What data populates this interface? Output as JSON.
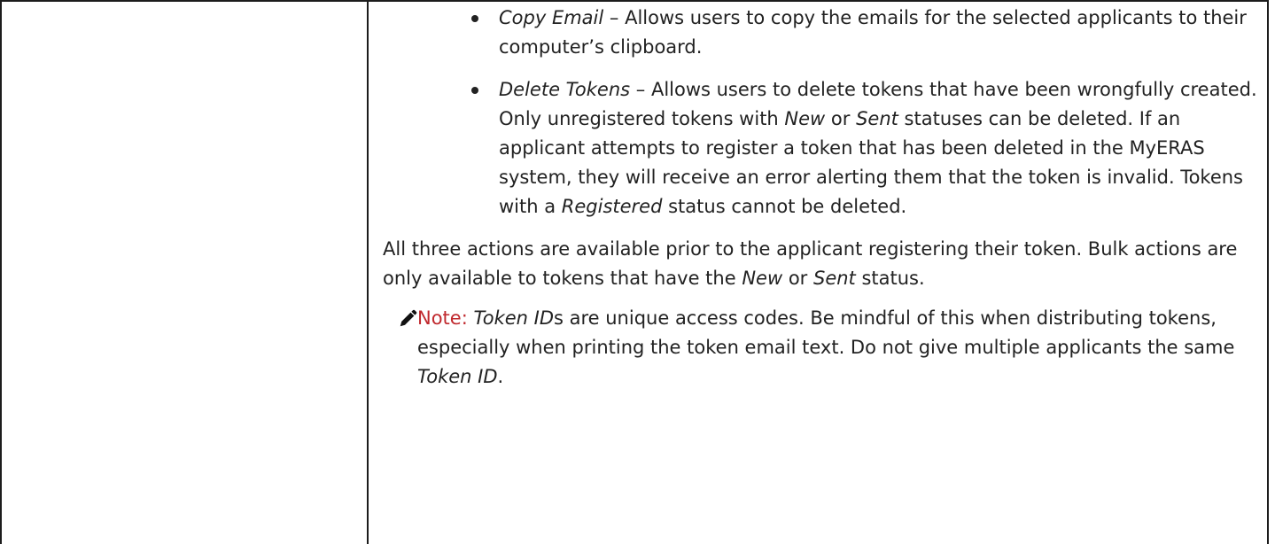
{
  "bullets": [
    {
      "term": "Copy Email",
      "dash": " – ",
      "text": "Allows users to copy the emails for the selected applicants to their computer’s clipboard."
    },
    {
      "term": "Delete Tokens",
      "dash": " – ",
      "text_1": "Allows users to delete tokens that have been wrongfully created. Only unregistered tokens with ",
      "em_1": "New",
      "text_2": " or ",
      "em_2": "Sent",
      "text_3": " statuses can be deleted. If an applicant attempts to register a token that has been deleted in the MyERAS system, they will receive an error alerting them that the token is invalid. Tokens with a ",
      "em_3": "Registered",
      "text_4": " status cannot be deleted."
    }
  ],
  "paragraph": {
    "line_1": "All three actions are available prior to the applicant registering their token. Bulk actions are only available to tokens that have the ",
    "em_1": "New",
    "text_2": " or ",
    "em_2": "Sent",
    "text_3": " status."
  },
  "note": {
    "icon": "pencil-icon",
    "label": "Note:",
    "em_1": "Token ID",
    "text_1": "s are unique access codes. Be mindful of this when distributing tokens, especially when printing the token email text. Do not give multiple applicants the same ",
    "em_2": "Token ID",
    "text_2": "."
  },
  "colors": {
    "note_label": "#c0282d",
    "border": "#1c1c1c",
    "text": "#222222"
  }
}
